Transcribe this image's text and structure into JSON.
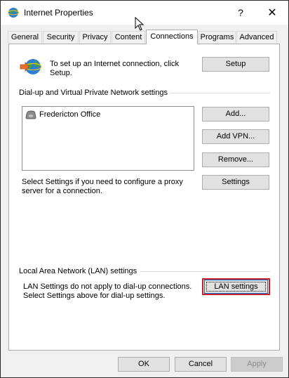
{
  "window": {
    "title": "Internet Properties",
    "help_glyph": "?",
    "close_glyph": "✕"
  },
  "tabs": [
    {
      "label": "General"
    },
    {
      "label": "Security"
    },
    {
      "label": "Privacy"
    },
    {
      "label": "Content"
    },
    {
      "label": "Connections",
      "active": true
    },
    {
      "label": "Programs"
    },
    {
      "label": "Advanced"
    }
  ],
  "setup": {
    "text_line1": "To set up an Internet connection, click",
    "text_line2": "Setup.",
    "button": "Setup"
  },
  "dialup": {
    "heading": "Dial-up and Virtual Private Network settings",
    "connections": [
      {
        "name": "Fredericton Office"
      }
    ],
    "add_button": "Add...",
    "add_vpn_button": "Add VPN...",
    "remove_button": "Remove...",
    "proxy_text_line1": "Select Settings if you need to configure a proxy",
    "proxy_text_line2": "server for a connection.",
    "settings_button": "Settings"
  },
  "lan": {
    "heading": "Local Area Network (LAN) settings",
    "text_line1": "LAN Settings do not apply to dial-up connections.",
    "text_line2": "Select Settings above for dial-up settings.",
    "button": "LAN settings"
  },
  "footer": {
    "ok": "OK",
    "cancel": "Cancel",
    "apply": "Apply"
  },
  "colors": {
    "highlight": "#d11a2a",
    "focus_border": "#0078d7"
  }
}
